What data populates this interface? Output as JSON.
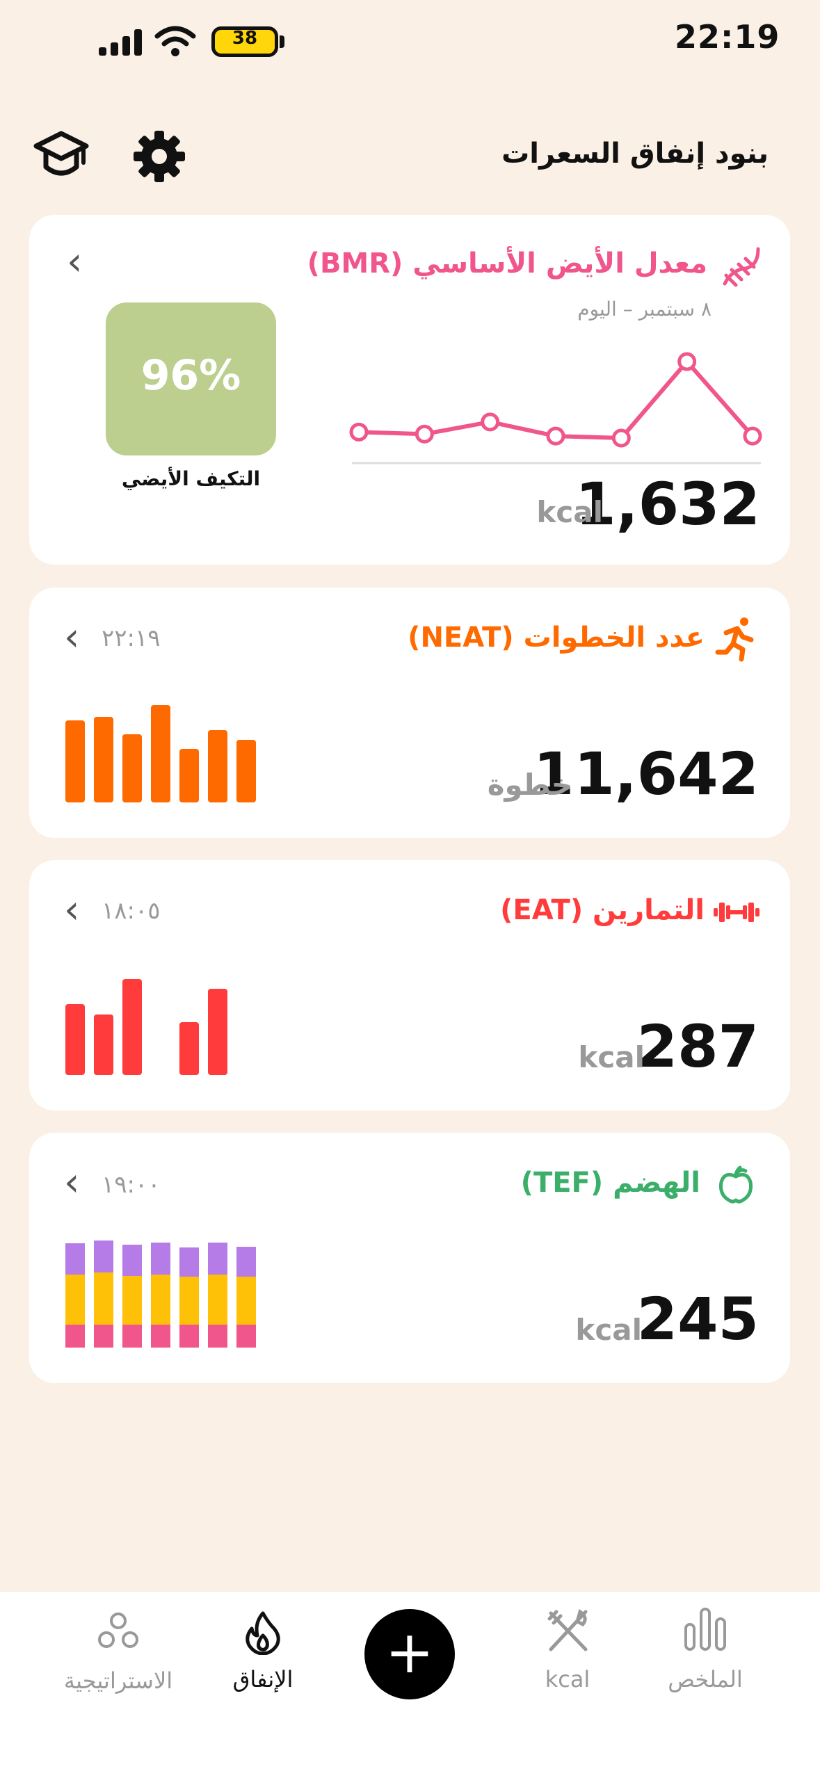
{
  "status": {
    "time": "22:19",
    "battery": "38"
  },
  "header": {
    "title": "بنود إنفاق السعرات"
  },
  "bmr": {
    "title": "معدل الأيض الأساسي (BMR)",
    "subtitle": "٨ سبتمبر – اليوم",
    "value": "1,632",
    "unit": "kcal",
    "badge": "96%",
    "badge_label": "التكيف الأيضي",
    "accent": "#F0568C",
    "badge_color": "#BCCF8E",
    "trend": [
      1635,
      1634,
      1640,
      1633,
      1632,
      1670,
      1633
    ]
  },
  "neat": {
    "title": "عدد الخطوات (NEAT)",
    "time": "٢٢:١٩",
    "value": "11,642",
    "unit": "خطوة",
    "accent": "#FF6A00",
    "bars": [
      0.84,
      0.88,
      0.7,
      1.0,
      0.55,
      0.74,
      0.64
    ]
  },
  "eat": {
    "title": "التمارين (EAT)",
    "time": "١٨:٠٥",
    "value": "287",
    "unit": "kcal",
    "accent": "#FF3B3B",
    "bars": [
      0.74,
      0.63,
      1.0,
      0,
      0.55,
      0.9,
      0
    ]
  },
  "tef": {
    "title": "الهضم (TEF)",
    "time": "١٩:٠٠",
    "value": "245",
    "unit": "kcal",
    "accent": "#3BAF6A",
    "segment_colors": [
      "#F0568C",
      "#FFC107",
      "#B57BE6"
    ],
    "stacks": [
      [
        0.22,
        0.48,
        0.3
      ],
      [
        0.22,
        0.5,
        0.31
      ],
      [
        0.22,
        0.47,
        0.3
      ],
      [
        0.22,
        0.48,
        0.31
      ],
      [
        0.22,
        0.46,
        0.28
      ],
      [
        0.22,
        0.48,
        0.31
      ],
      [
        0.22,
        0.46,
        0.29
      ]
    ]
  },
  "nav": {
    "strategy": "الاستراتيجية",
    "spending": "الإنفاق",
    "add": "+",
    "kcal": "kcal",
    "summary": "الملخص"
  }
}
